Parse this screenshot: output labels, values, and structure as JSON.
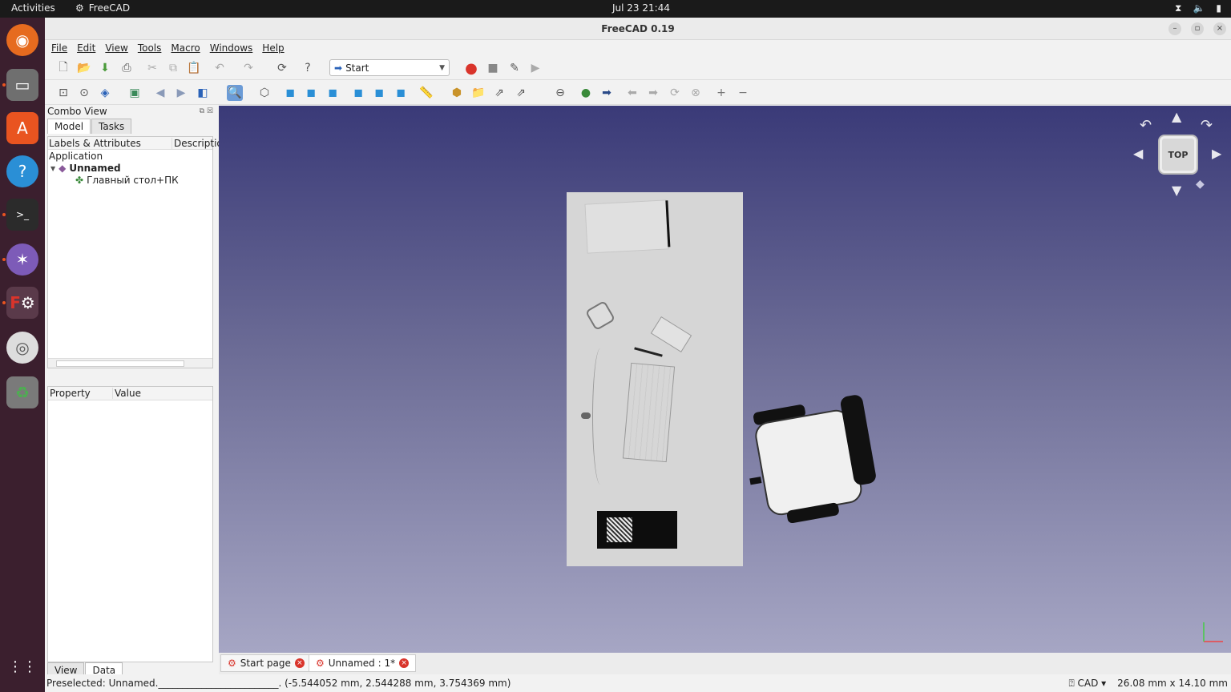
{
  "topbar": {
    "activities": "Activities",
    "app": "FreeCAD",
    "clock": "Jul 23  21:44"
  },
  "window": {
    "title": "FreeCAD 0.19"
  },
  "menu": [
    "File",
    "Edit",
    "View",
    "Tools",
    "Macro",
    "Windows",
    "Help"
  ],
  "workbench": {
    "selected": "Start"
  },
  "combo": {
    "title": "Combo View",
    "tabs": [
      "Model",
      "Tasks"
    ],
    "tree_headers": [
      "Labels & Attributes",
      "Descriptio"
    ],
    "tree": {
      "root": "Application",
      "document": "Unnamed",
      "child": "Главный стол+ПК"
    },
    "prop_headers": [
      "Property",
      "Value"
    ],
    "bottom_tabs": [
      "View",
      "Data"
    ]
  },
  "navcube": {
    "face": "TOP"
  },
  "doctabs": [
    "Start page",
    "Unnamed : 1*"
  ],
  "status": {
    "message": "Preselected: Unnamed._________________________. (-5.544052 mm, 2.544288 mm, 3.754369 mm)",
    "nav_style": "CAD",
    "dimensions": "26.08 mm x 14.10 mm"
  },
  "colors": {
    "dock": "#3b1f2e",
    "accent": "#e95420",
    "viewport_top": "#3a3a78",
    "viewport_bottom": "#a6a6c4"
  }
}
